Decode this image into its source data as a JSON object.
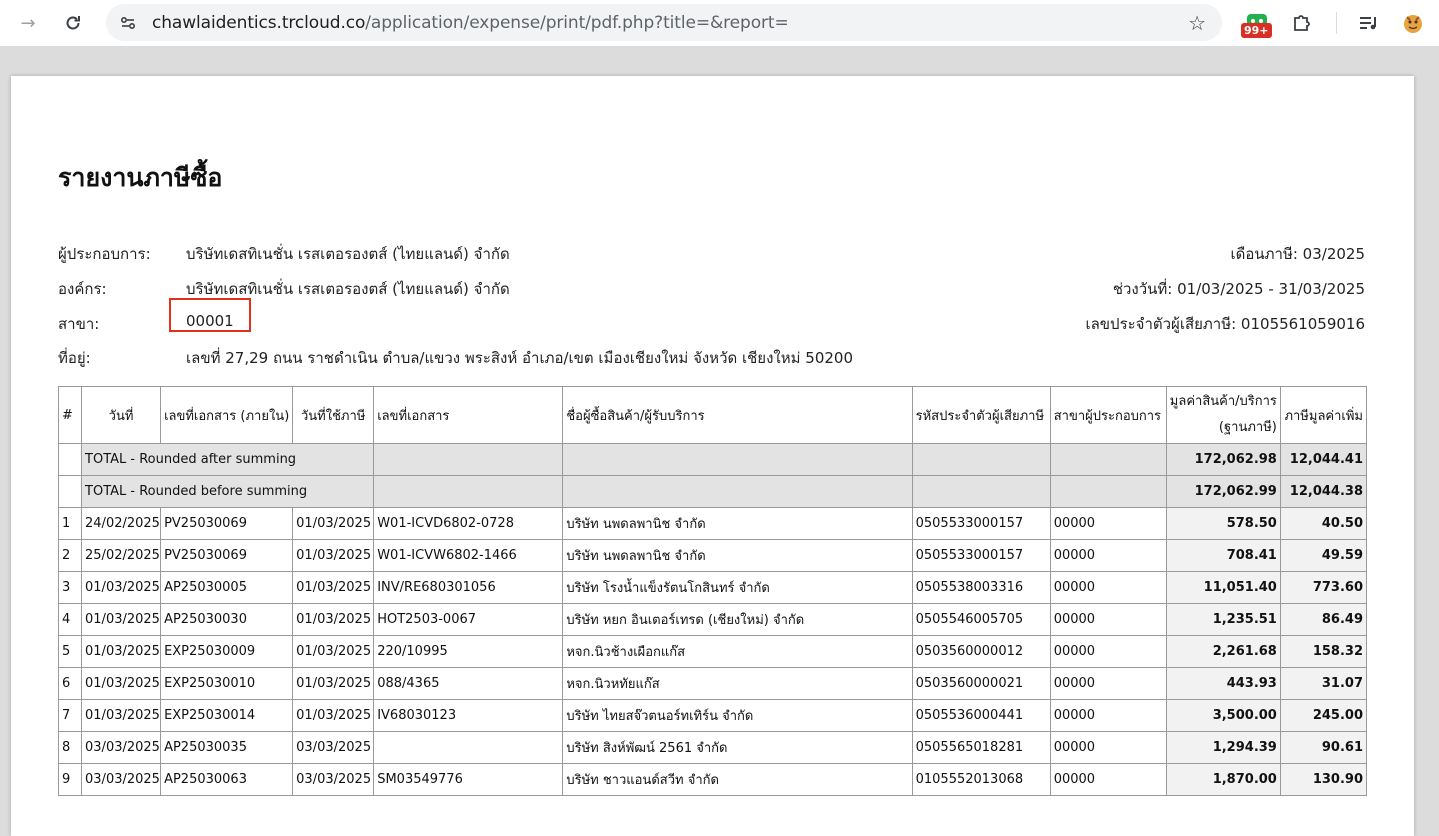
{
  "browser": {
    "url_host": "chawlaidentics.trcloud.co",
    "url_path": "/application/expense/print/pdf.php?title=&report=",
    "badge": "99+"
  },
  "report": {
    "title": "รายงานภาษีซื้อ",
    "operator_label": "ผู้ประกอบการ:",
    "operator_value": "บริษัทเดสทิเนชั่น เรสเตอรองตส์ (ไทยแลนด์) จำกัด",
    "org_label": "องค์กร:",
    "org_value": "บริษัทเดสทิเนชั่น เรสเตอรองตส์ (ไทยแลนด์) จำกัด",
    "branch_label": "สาขา:",
    "branch_value": "00001",
    "address_label": "ที่อยู่:",
    "address_value": "เลขที่ 27,29 ถนน ราชดำเนิน ตำบล/แขวง พระสิงห์ อำเภอ/เขต เมืองเชียงใหม่ จังหวัด เชียงใหม่ 50200",
    "tax_month": "เดือนภาษี: 03/2025",
    "date_range": "ช่วงวันที่: 01/03/2025 - 31/03/2025",
    "tax_id": "เลขประจำตัวผู้เสียภาษี: 0105561059016"
  },
  "table": {
    "headers": [
      "#",
      "วันที่",
      "เลขที่เอกสาร (ภายใน)",
      "วันที่ใช้ภาษี",
      "เลขที่เอกสาร",
      "ชื่อผู้ซื้อสินค้า/ผู้รับบริการ",
      "รหัสประจำตัวผู้เสียภาษี",
      "สาขาผู้ประกอบการ",
      "มูลค่าสินค้า/บริการ",
      "(ฐานภาษี)",
      "ภาษีมูลค่าเพิ่ม"
    ],
    "totals": [
      {
        "label": "TOTAL - Rounded after summing",
        "amount": "172,062.98",
        "vat": "12,044.41"
      },
      {
        "label": "TOTAL - Rounded before summing",
        "amount": "172,062.99",
        "vat": "12,044.38"
      }
    ],
    "rows": [
      {
        "no": "1",
        "date": "24/02/2025",
        "doc": "PV25030069",
        "tax_date": "01/03/2025",
        "ref": "W01-ICVD6802-0728",
        "name": "บริษัท นพดลพานิช จำกัด",
        "tax_id": "0505533000157",
        "branch": "00000",
        "amount": "578.50",
        "vat": "40.50"
      },
      {
        "no": "2",
        "date": "25/02/2025",
        "doc": "PV25030069",
        "tax_date": "01/03/2025",
        "ref": "W01-ICVW6802-1466",
        "name": "บริษัท นพดลพานิช จำกัด",
        "tax_id": "0505533000157",
        "branch": "00000",
        "amount": "708.41",
        "vat": "49.59"
      },
      {
        "no": "3",
        "date": "01/03/2025",
        "doc": "AP25030005",
        "tax_date": "01/03/2025",
        "ref": "INV/RE680301056",
        "name": "บริษัท โรงน้ำแข็งรัตนโกสินทร์ จำกัด",
        "tax_id": "0505538003316",
        "branch": "00000",
        "amount": "11,051.40",
        "vat": "773.60"
      },
      {
        "no": "4",
        "date": "01/03/2025",
        "doc": "AP25030030",
        "tax_date": "01/03/2025",
        "ref": "HOT2503-0067",
        "name": "บริษัท หยก อินเตอร์เทรด (เชียงใหม่) จำกัด",
        "tax_id": "0505546005705",
        "branch": "00000",
        "amount": "1,235.51",
        "vat": "86.49"
      },
      {
        "no": "5",
        "date": "01/03/2025",
        "doc": "EXP25030009",
        "tax_date": "01/03/2025",
        "ref": "220/10995",
        "name": "หจก.นิวช้างเผือกแก๊ส",
        "tax_id": "0503560000012",
        "branch": "00000",
        "amount": "2,261.68",
        "vat": "158.32"
      },
      {
        "no": "6",
        "date": "01/03/2025",
        "doc": "EXP25030010",
        "tax_date": "01/03/2025",
        "ref": "088/4365",
        "name": "หจก.นิวหทัยแก๊ส",
        "tax_id": "0503560000021",
        "branch": "00000",
        "amount": "443.93",
        "vat": "31.07"
      },
      {
        "no": "7",
        "date": "01/03/2025",
        "doc": "EXP25030014",
        "tax_date": "01/03/2025",
        "ref": "IV68030123",
        "name": "บริษัท ไทยสจ๊วตนอร์ทเทิร์น จำกัด",
        "tax_id": "0505536000441",
        "branch": "00000",
        "amount": "3,500.00",
        "vat": "245.00"
      },
      {
        "no": "8",
        "date": "03/03/2025",
        "doc": "AP25030035",
        "tax_date": "03/03/2025",
        "ref": "",
        "name": "บริษัท สิงห์พัฒน์ 2561 จำกัด",
        "tax_id": "0505565018281",
        "branch": "00000",
        "amount": "1,294.39",
        "vat": "90.61"
      },
      {
        "no": "9",
        "date": "03/03/2025",
        "doc": "AP25030063",
        "tax_date": "03/03/2025",
        "ref": "SM03549776",
        "name": "บริษัท ชาวแอนด์สวีท จำกัด",
        "tax_id": "0105552013068",
        "branch": "00000",
        "amount": "1,870.00",
        "vat": "130.90"
      }
    ]
  }
}
